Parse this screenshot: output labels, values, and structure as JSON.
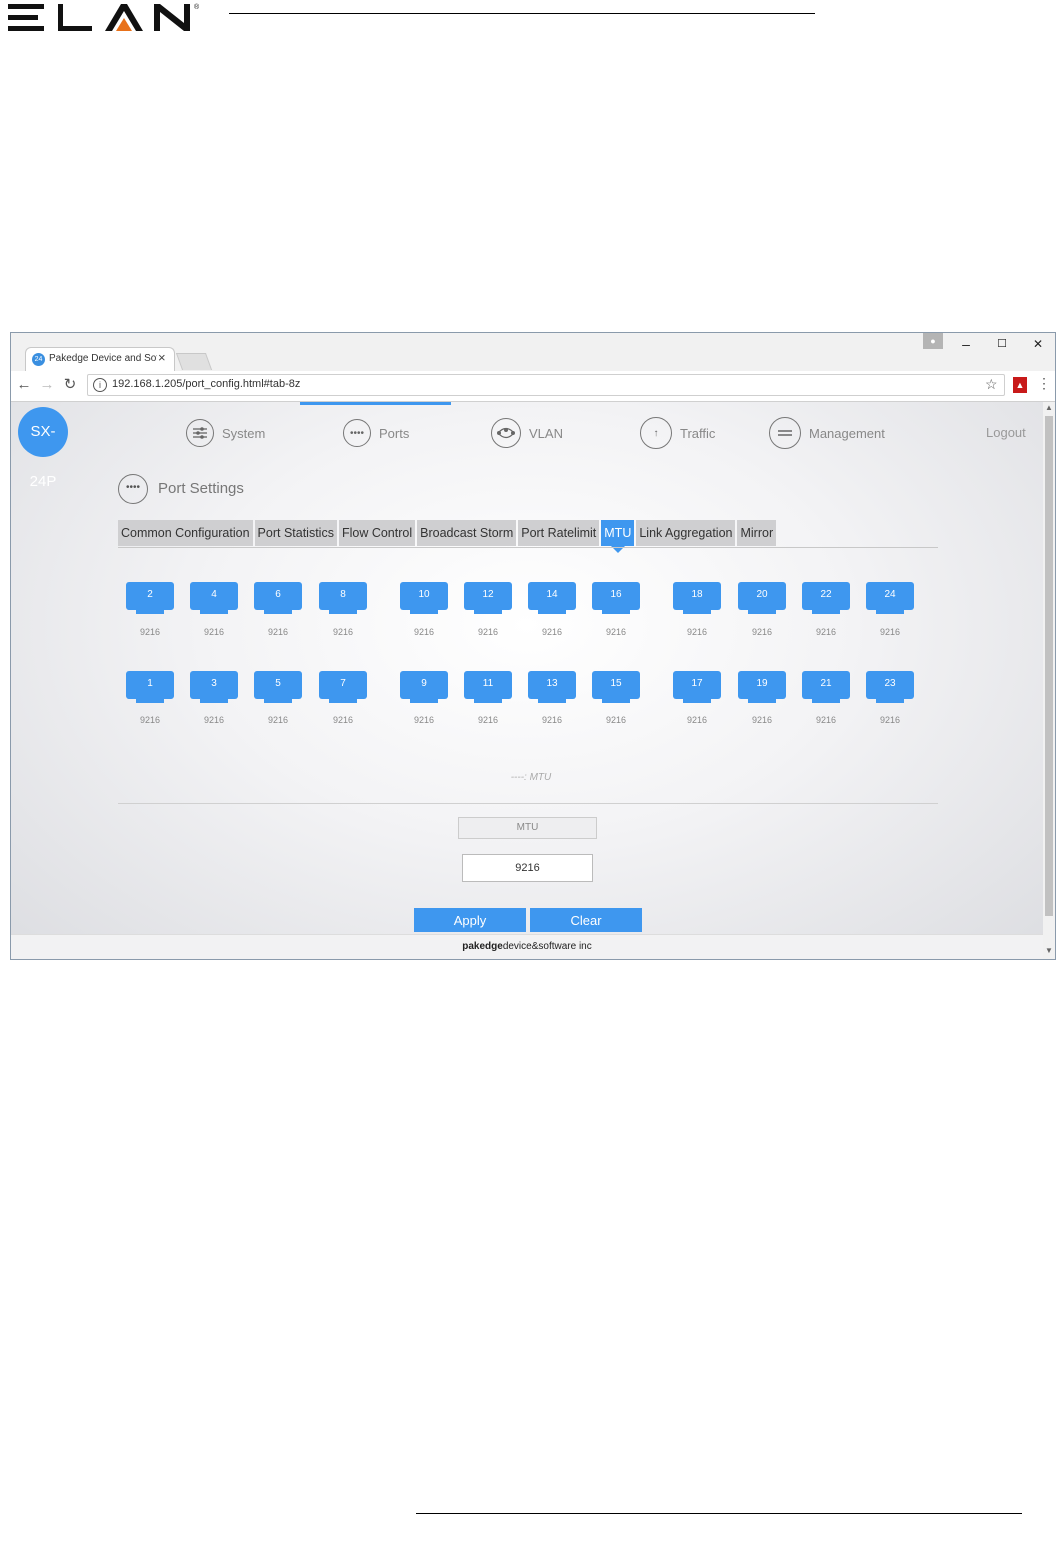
{
  "doc": {
    "logo_text": "ELAN",
    "logo_mark": "®"
  },
  "browser": {
    "tab_title": "Pakedge Device and Soft",
    "tab_favicon": "24",
    "url": "192.168.1.205/port_config.html#tab-8z",
    "window_controls": {
      "minimize": "–",
      "maximize": "☐",
      "close": "✕"
    },
    "profile_icon": "person-icon"
  },
  "app": {
    "device": "SX-24P",
    "nav": [
      {
        "label": "System",
        "icon": "sliders-icon"
      },
      {
        "label": "Ports",
        "icon": "ports-icon"
      },
      {
        "label": "VLAN",
        "icon": "network-icon"
      },
      {
        "label": "Traffic",
        "icon": "arrow-up-icon"
      },
      {
        "label": "Management",
        "icon": "menu-icon"
      }
    ],
    "active_nav": "Ports",
    "logout": "Logout",
    "section_title": "Port Settings",
    "tabs": [
      "Common Configuration",
      "Port Statistics",
      "Flow Control",
      "Broadcast Storm",
      "Port Ratelimit",
      "MTU",
      "Link Aggregation",
      "Mirror"
    ],
    "active_tab": "MTU",
    "ports_top": [
      {
        "id": "2",
        "mtu": "9216"
      },
      {
        "id": "4",
        "mtu": "9216"
      },
      {
        "id": "6",
        "mtu": "9216"
      },
      {
        "id": "8",
        "mtu": "9216"
      },
      {
        "id": "10",
        "mtu": "9216"
      },
      {
        "id": "12",
        "mtu": "9216"
      },
      {
        "id": "14",
        "mtu": "9216"
      },
      {
        "id": "16",
        "mtu": "9216"
      },
      {
        "id": "18",
        "mtu": "9216"
      },
      {
        "id": "20",
        "mtu": "9216"
      },
      {
        "id": "22",
        "mtu": "9216"
      },
      {
        "id": "24",
        "mtu": "9216"
      }
    ],
    "ports_bottom": [
      {
        "id": "1",
        "mtu": "9216"
      },
      {
        "id": "3",
        "mtu": "9216"
      },
      {
        "id": "5",
        "mtu": "9216"
      },
      {
        "id": "7",
        "mtu": "9216"
      },
      {
        "id": "9",
        "mtu": "9216"
      },
      {
        "id": "11",
        "mtu": "9216"
      },
      {
        "id": "13",
        "mtu": "9216"
      },
      {
        "id": "15",
        "mtu": "9216"
      },
      {
        "id": "17",
        "mtu": "9216"
      },
      {
        "id": "19",
        "mtu": "9216"
      },
      {
        "id": "21",
        "mtu": "9216"
      },
      {
        "id": "23",
        "mtu": "9216"
      }
    ],
    "legend": "----: MTU",
    "mtu_field_label": "MTU",
    "mtu_value": "9216",
    "apply": "Apply",
    "clear": "Clear",
    "footer_brand": "pakedge",
    "footer_rest": "device&software inc",
    "accent_color": "#3e97ef"
  }
}
